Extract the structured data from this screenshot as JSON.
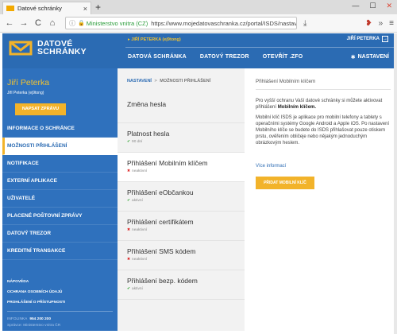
{
  "browser": {
    "tab_title": "Datové schránky",
    "tab_close": "×",
    "new_tab": "+",
    "nav_back": "←",
    "nav_forward": "→",
    "nav_reload": "C",
    "nav_home": "⌂",
    "url_info": "ⓘ",
    "url_lock": "🔒",
    "url_org": "Ministerstvo vnitra (CZ)",
    "url_text": "https://www.mojedatovaschranka.cz/portal/ISDS/nastaveni/zo",
    "url_menu": "···",
    "url_star": "☆",
    "download": "⤓",
    "addon": "❥",
    "tools_more": "»",
    "menu": "≡",
    "win_min": "—",
    "win_max": "☐",
    "win_close": "✕"
  },
  "header": {
    "logo_line1": "DATOVÉ",
    "logo_line2": "SCHRÁNKY",
    "user_line": "▸ JIŘÍ PETERKA (ej9tong)",
    "logout_label": "JIŘÍ PETERKA",
    "logout_icon": "→",
    "nav": [
      "DATOVÁ SCHRÁNKA",
      "DATOVÝ TREZOR",
      "OTEVŘÍT .ZFO"
    ],
    "settings_icon": "✱",
    "settings_label": "NASTAVENÍ"
  },
  "sidebar": {
    "name": "Jiří Peterka",
    "login": "Jiří Peterka (ej9tong)",
    "write_button": "NAPSAT ZPRÁVU",
    "items": [
      {
        "label": "INFORMACE O SCHRÁNCE"
      },
      {
        "label": "MOŽNOSTI PŘIHLÁŠENÍ"
      },
      {
        "label": "NOTIFIKACE"
      },
      {
        "label": "EXTERNÍ APLIKACE"
      },
      {
        "label": "UŽIVATELÉ"
      },
      {
        "label": "PLACENÉ POŠTOVNÍ ZPRÁVY"
      },
      {
        "label": "DATOVÝ TREZOR"
      },
      {
        "label": "KREDITNÍ TRANSAKCE"
      }
    ],
    "bottom_links": [
      "NÁPOVĚDA",
      "OCHRANA OSOBNÍCH ÚDAJŮ",
      "PROHLÁŠENÍ O PŘÍSTUPNOSTI"
    ],
    "phone_label": "INFOLINKA",
    "phone_number": "954 200 200",
    "admin": "Správce: Ministerstvo vnitra ČR"
  },
  "middle": {
    "breadcrumb_root": "NASTAVENÍ",
    "breadcrumb_sep": ">",
    "breadcrumb_current": "MOŽNOSTI PŘIHLÁŠENÍ",
    "items": [
      {
        "title": "Změna hesla",
        "status": "",
        "state": "none"
      },
      {
        "title": "Platnost hesla",
        "status": "90 dní",
        "state": "ok"
      },
      {
        "title": "Přihlášení Mobilním klíčem",
        "status": "neaktivní",
        "state": "no"
      },
      {
        "title": "Přihlášení eObčankou",
        "status": "aktivní",
        "state": "ok"
      },
      {
        "title": "Přihlášení certifikátem",
        "status": "neaktivní",
        "state": "no"
      },
      {
        "title": "Přihlášení SMS kódem",
        "status": "neaktivní",
        "state": "no"
      },
      {
        "title": "Přihlášení bezp. kódem",
        "status": "aktivní",
        "state": "ok"
      }
    ],
    "icon_ok": "✔",
    "icon_no": "✖"
  },
  "content": {
    "title": "Přihlášení Mobilním klíčem",
    "p1_text": "Pro vyšší ochranu Vaší datové schránky si můžete aktivovat přihlášení",
    "p1_bold": "Mobilním klíčem.",
    "p2": "Mobilní klíč ISDS je aplikace pro mobilní telefony a tablety s operačními systémy Google Android a Apple iOS. Po nastavení Mobilního klíče se budete do ISDS přihlašovat pouze otiskem prstu, ověřením obličeje nebo nějakým jednoduchým obrázkovým heslem.",
    "more_link": "Více informací",
    "add_button": "PŘIDAT MOBILNÍ KLÍČ"
  },
  "colors": {
    "brand_blue": "#2b6bb3",
    "accent_yellow": "#f2b32a",
    "ok_green": "#2aa12a",
    "inactive_red": "#dd2222"
  }
}
